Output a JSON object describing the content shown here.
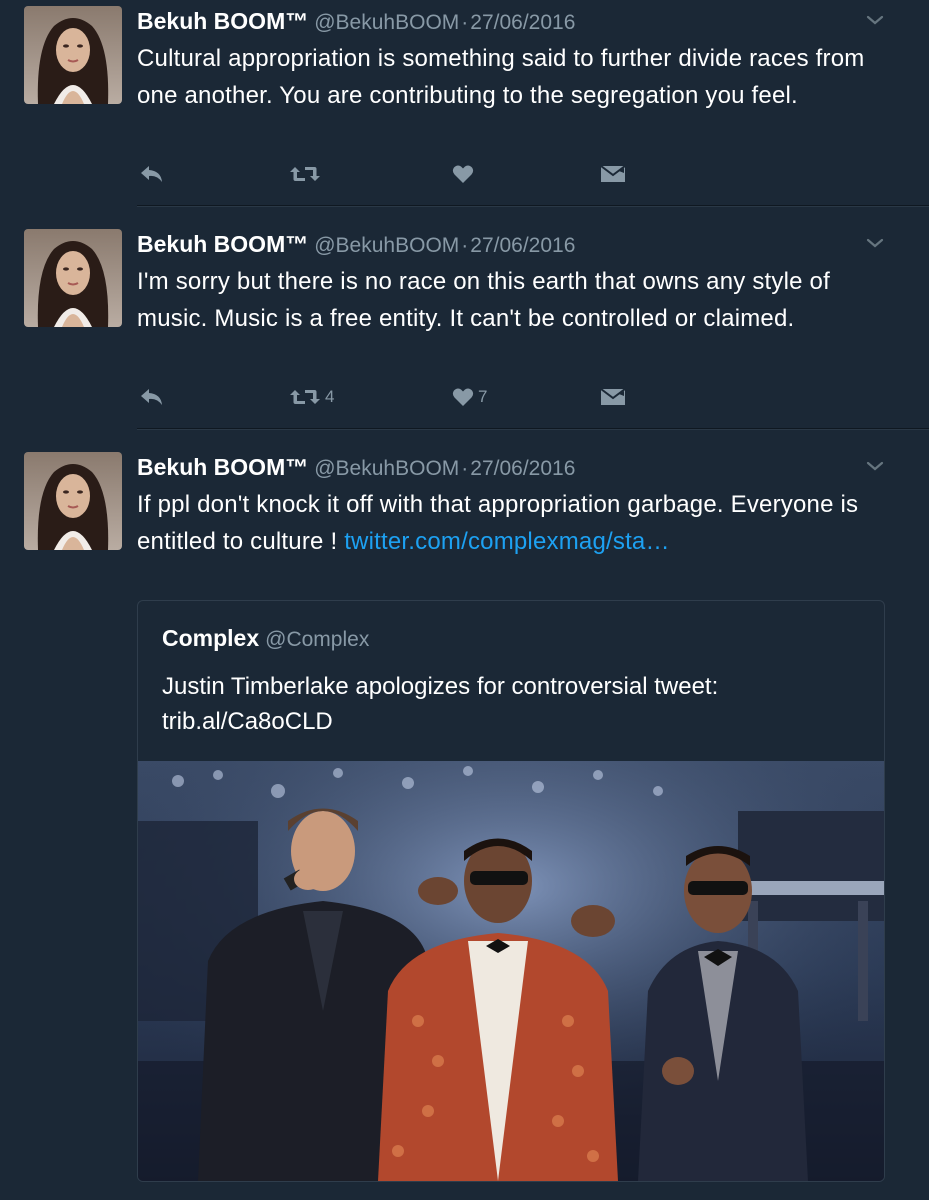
{
  "tweets": [
    {
      "name": "Bekuh BOOM™",
      "handle": "@BekuhBOOM",
      "separator": "·",
      "date": "27/06/2016",
      "text": "Cultural appropriation is something said to further divide races from one another. You are contributing to the segregation you feel.",
      "retweet_count": "",
      "like_count": ""
    },
    {
      "name": "Bekuh BOOM™",
      "handle": "@BekuhBOOM",
      "separator": "·",
      "date": "27/06/2016",
      "text": "I'm sorry but there is no race on this earth that owns any style of music. Music is a free entity. It can't be controlled or claimed.",
      "retweet_count": "4",
      "like_count": "7"
    },
    {
      "name": "Bekuh BOOM™",
      "handle": "@BekuhBOOM",
      "separator": "·",
      "date": "27/06/2016",
      "text": "If ppl don't knock it off with that appropriation garbage. Everyone is entitled to culture ! ",
      "link_text": "twitter.com/complexmag/sta…",
      "retweet_count": "",
      "like_count": "",
      "quoted": {
        "name": "Complex",
        "handle": "@Complex",
        "text_line1": "Justin Timberlake apologizes for controversial tweet:",
        "text_line2": "trib.al/Ca8oCLD"
      }
    }
  ],
  "icons": {
    "reply": "reply-icon",
    "retweet": "retweet-icon",
    "like": "heart-icon",
    "dm": "direct-message-icon",
    "more": "chevron-down-icon"
  },
  "colors": {
    "background": "#1b2836",
    "text": "#ffffff",
    "muted": "#8899a6",
    "link": "#1da1f2"
  }
}
